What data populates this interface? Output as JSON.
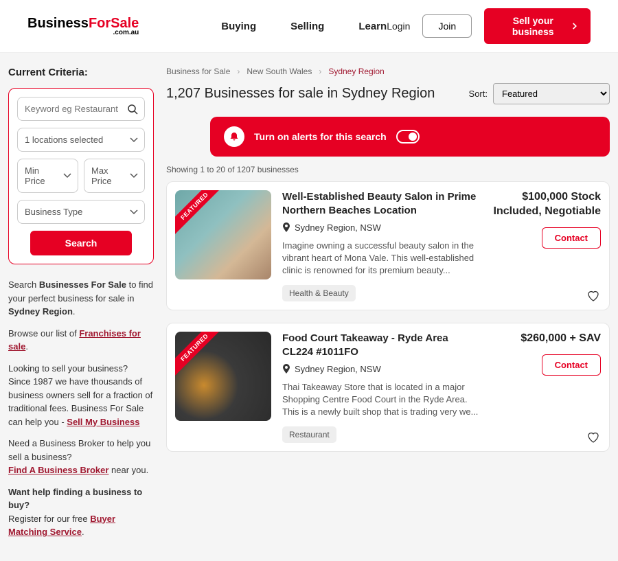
{
  "header": {
    "logo_business": "Business",
    "logo_forsale": "ForSale",
    "logo_sub": ".com.au",
    "nav": {
      "buying": "Buying",
      "selling": "Selling",
      "learn": "Learn"
    },
    "login": "Login",
    "join": "Join",
    "sell": "Sell your business"
  },
  "sidebar": {
    "criteria_title": "Current Criteria:",
    "keyword_placeholder": "Keyword eg Restaurant",
    "locations_label": "1 locations selected",
    "min_price": "Min Price",
    "max_price": "Max Price",
    "business_type": "Business Type",
    "search_btn": "Search",
    "p1_a": "Search ",
    "p1_b": "Businesses For Sale",
    "p1_c": " to find your perfect business for sale in ",
    "p1_d": "Sydney Region",
    "p1_e": ".",
    "p2_a": "Browse our list of ",
    "p2_b": "Franchises for sale",
    "p2_c": ".",
    "p3_a": "Looking to sell your business?",
    "p3_b": "Since 1987 we have thousands of business owners sell for a fraction of traditional fees. Business For Sale can help you - ",
    "p3_c": "Sell My Business",
    "p4_a": "Need a Business Broker to help you sell a business?",
    "p4_b": "Find A Business Broker",
    "p4_c": " near you.",
    "p5_a": "Want help finding a business to buy?",
    "p5_b": "Register for our free ",
    "p5_c": "Buyer Matching Service",
    "p5_d": "."
  },
  "main": {
    "breadcrumb": {
      "a": "Business for Sale",
      "b": "New South Wales",
      "c": "Sydney Region"
    },
    "title": "1,207 Businesses for sale in Sydney Region",
    "sort_label": "Sort:",
    "sort_value": "Featured",
    "alerts_text": "Turn on alerts for this search",
    "showing": "Showing 1 to 20 of 1207 businesses",
    "contact": "Contact",
    "featured_ribbon": "FEATURED",
    "listings": [
      {
        "title": "Well-Established Beauty Salon in Prime Northern Beaches Location",
        "location": "Sydney Region, NSW",
        "desc": "Imagine owning a successful beauty salon in the vibrant heart of Mona Vale. This well-established clinic is renowned for its premium beauty...",
        "tag": "Health & Beauty",
        "price": "$100,000 Stock Included, Negotiable"
      },
      {
        "title": "Food Court Takeaway - Ryde Area CL224 #1011FO",
        "location": "Sydney Region, NSW",
        "desc": "Thai Takeaway Store that is located in a major Shopping Centre Food Court in the Ryde Area. This is a newly built shop that is trading very we...",
        "tag": "Restaurant",
        "price": "$260,000 + SAV"
      }
    ]
  }
}
